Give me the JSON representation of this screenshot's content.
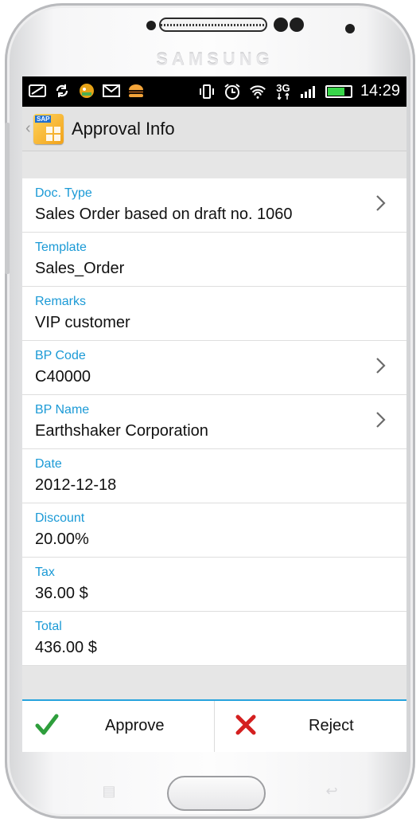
{
  "device": {
    "brand": "SAMSUNG"
  },
  "status_bar": {
    "left_icons": [
      "sim-icon",
      "sync-icon",
      "notification-app-icon",
      "email-icon",
      "burger-icon"
    ],
    "right_icons": [
      "vibrate-icon",
      "alarm-icon",
      "wifi-icon",
      "3g-icon",
      "signal-icon",
      "battery-icon"
    ],
    "network": "3G",
    "time": "14:29"
  },
  "action_bar": {
    "title": "Approval Info"
  },
  "fields": [
    {
      "label": "Doc. Type",
      "value": "Sales Order based on draft no. 1060",
      "has_chevron": true
    },
    {
      "label": "Template",
      "value": "Sales_Order",
      "has_chevron": false
    },
    {
      "label": "Remarks",
      "value": "VIP customer",
      "has_chevron": false
    },
    {
      "label": "BP Code",
      "value": "C40000",
      "has_chevron": true
    },
    {
      "label": "BP Name",
      "value": "Earthshaker Corporation",
      "has_chevron": true
    },
    {
      "label": "Date",
      "value": "2012-12-18",
      "has_chevron": false
    },
    {
      "label": "Discount",
      "value": "20.00%",
      "has_chevron": false
    },
    {
      "label": "Tax",
      "value": "36.00 $",
      "has_chevron": false
    },
    {
      "label": "Total",
      "value": "436.00 $",
      "has_chevron": false
    }
  ],
  "actions": {
    "approve_label": "Approve",
    "reject_label": "Reject"
  },
  "colors": {
    "label_blue": "#1b9ad6",
    "approve_green": "#2e9e3c",
    "reject_red": "#d42020",
    "bar_accent": "#27a3dd"
  }
}
